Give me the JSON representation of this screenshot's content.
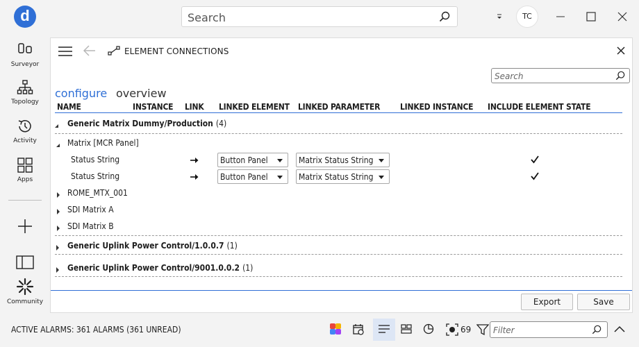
{
  "app": {
    "logo_letter": "d"
  },
  "top_search": {
    "placeholder": "Search"
  },
  "user": {
    "initials": "TC"
  },
  "rail": {
    "items": [
      {
        "label": "Surveyor",
        "icon": "surveyor-icon"
      },
      {
        "label": "Topology",
        "icon": "topology-icon"
      },
      {
        "label": "Activity",
        "icon": "activity-icon"
      },
      {
        "label": "Apps",
        "icon": "apps-icon"
      }
    ],
    "community_label": "Community"
  },
  "panel": {
    "title": "ELEMENT CONNECTIONS",
    "search_placeholder": "Search",
    "tabs": [
      {
        "label": "configure",
        "active": true
      },
      {
        "label": "overview",
        "active": false
      }
    ],
    "columns": [
      "NAME",
      "INSTANCE",
      "LINK",
      "LINKED ELEMENT",
      "LINKED PARAMETER",
      "LINKED INSTANCE",
      "INCLUDE ELEMENT STATE"
    ],
    "groups": [
      {
        "name": "Generic Matrix Dummy/Production",
        "count": "(4)",
        "expanded": true,
        "elements": [
          {
            "name": "Matrix [MCR Panel]",
            "expanded": true,
            "params": [
              {
                "name": "Status String",
                "linked_element": "Button Panel",
                "linked_parameter": "Matrix Status String",
                "include_state": true
              },
              {
                "name": "Status String",
                "linked_element": "Button Panel",
                "linked_parameter": "Matrix Status String",
                "include_state": true
              }
            ]
          },
          {
            "name": "ROME_MTX_001",
            "expanded": false
          },
          {
            "name": "SDI Matrix A",
            "expanded": false
          },
          {
            "name": "SDI Matrix B",
            "expanded": false
          }
        ]
      },
      {
        "name": "Generic Uplink Power Control/1.0.0.7",
        "count": "(1)",
        "expanded": false
      },
      {
        "name": "Generic Uplink Power Control/9001.0.0.2",
        "count": "(1)",
        "expanded": false
      }
    ],
    "buttons": {
      "export": "Export",
      "save": "Save"
    }
  },
  "statusbar": {
    "alarms_text": "ACTIVE ALARMS: 361 ALARMS (361 UNREAD)",
    "counter": "69",
    "filter_placeholder": "Filter"
  },
  "colors": {
    "accent": "#2f6fd6",
    "header_line": "#2f6fd6"
  }
}
